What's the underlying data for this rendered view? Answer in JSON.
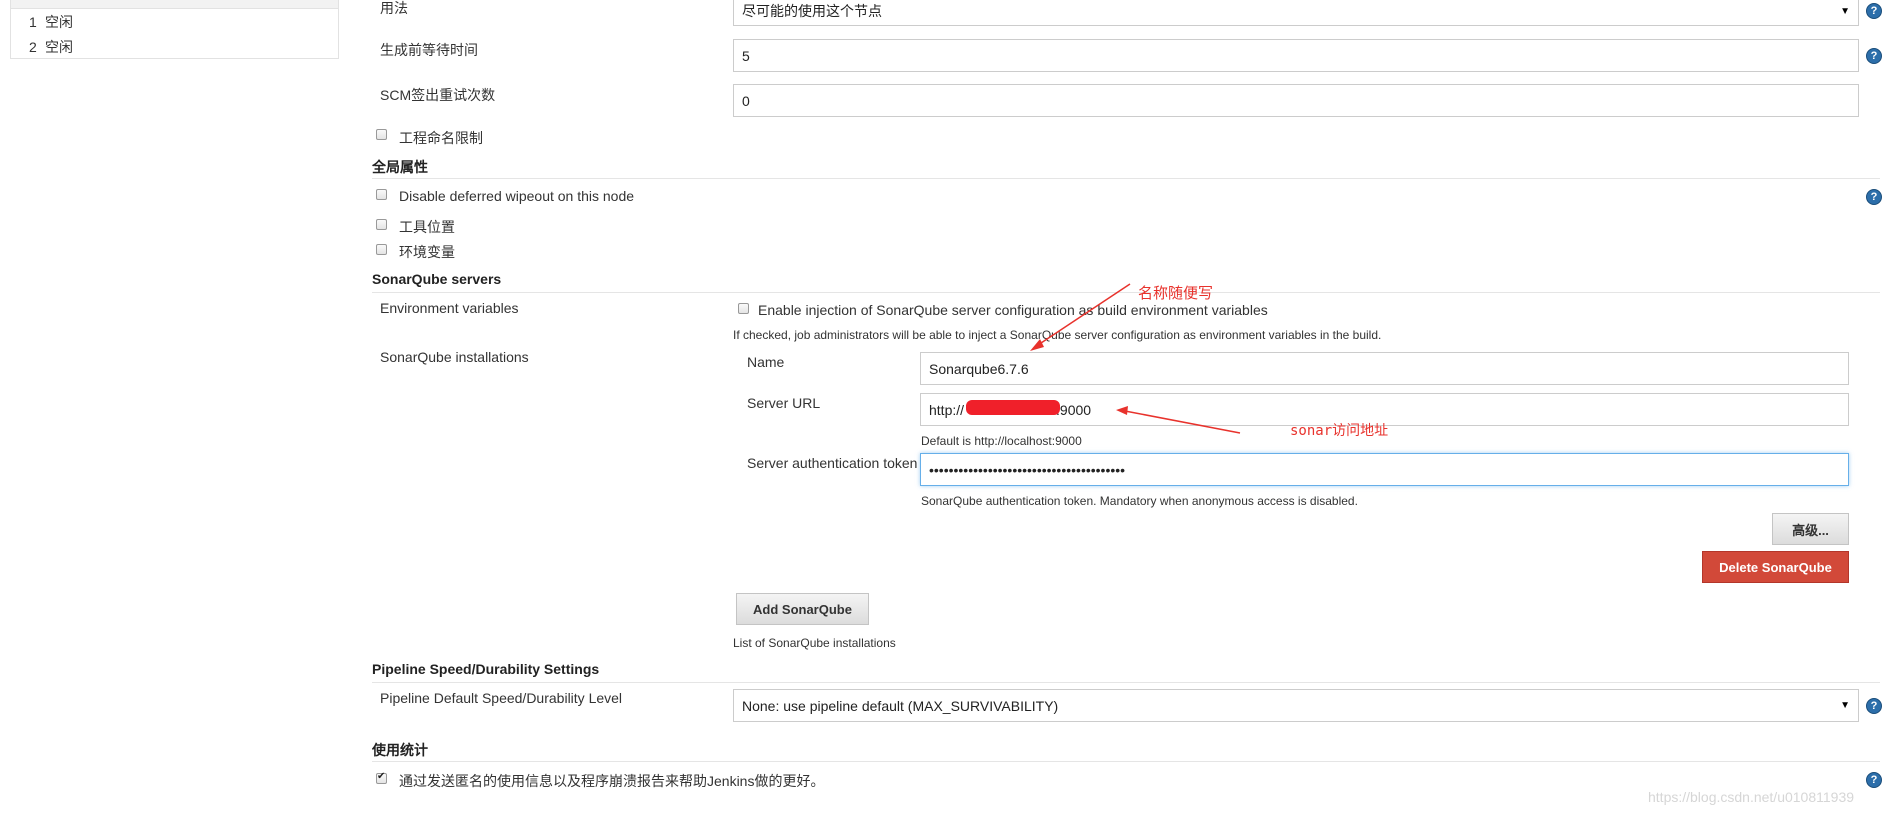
{
  "executors": [
    {
      "num": "1",
      "status": "空闲"
    },
    {
      "num": "2",
      "status": "空闲"
    }
  ],
  "usage": {
    "label": "用法",
    "value": "尽可能的使用这个节点"
  },
  "quiet_period": {
    "label": "生成前等待时间",
    "value": "5"
  },
  "scm_retry": {
    "label": "SCM签出重试次数",
    "value": "0"
  },
  "project_naming": {
    "label": "工程命名限制"
  },
  "global_props": {
    "title": "全局属性",
    "disable_wipeout": "Disable deferred wipeout on this node",
    "tool_locations": "工具位置",
    "env_vars": "环境变量"
  },
  "sonar": {
    "title": "SonarQube servers",
    "env_label": "Environment variables",
    "env_checkbox": "Enable injection of SonarQube server configuration as build environment variables",
    "env_help": "If checked, job administrators will be able to inject a SonarQube server configuration as environment variables in the build.",
    "installations_label": "SonarQube installations",
    "name_label": "Name",
    "name_value": "Sonarqube6.7.6",
    "url_label": "Server URL",
    "url_prefix": "http://",
    "url_suffix": ":9000",
    "url_help": "Default is http://localhost:9000",
    "token_label": "Server authentication token",
    "token_value": "••••••••••••••••••••••••••••••••••••••••",
    "token_help": "SonarQube authentication token. Mandatory when anonymous access is disabled.",
    "advanced_button": "高级...",
    "delete_button": "Delete SonarQube",
    "add_button": "Add SonarQube",
    "list_help": "List of SonarQube installations"
  },
  "annotations": {
    "name_note": "名称随便写",
    "url_note": "sonar访问地址"
  },
  "pipeline": {
    "title": "Pipeline Speed/Durability Settings",
    "label": "Pipeline Default Speed/Durability Level",
    "value": "None: use pipeline default (MAX_SURVIVABILITY)"
  },
  "usage_stats": {
    "title": "使用统计",
    "checkbox_label": "通过发送匿名的使用信息以及程序崩溃报告来帮助Jenkins做的更好。"
  },
  "watermark": "https://blog.csdn.net/u010811939",
  "colors": {
    "accent_red": "#d24939",
    "annotation_red": "#e8322c",
    "help_blue": "#2c6eaa"
  }
}
